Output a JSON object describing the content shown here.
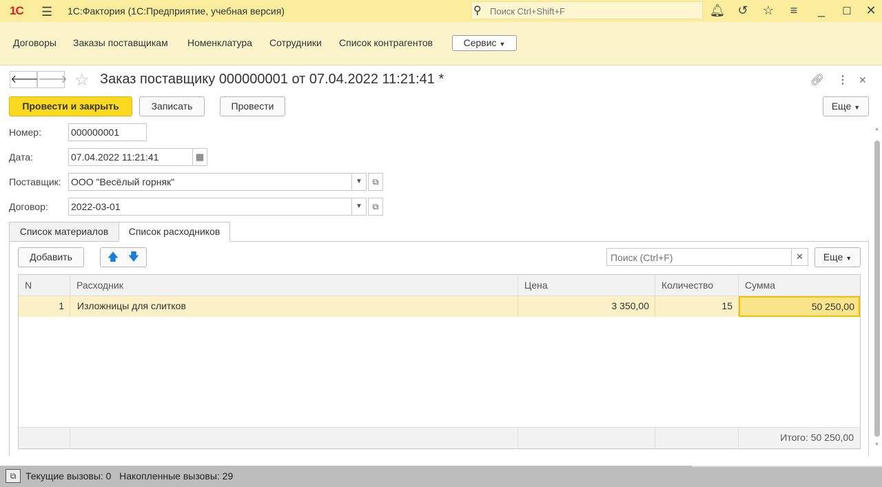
{
  "titlebar": {
    "logo": "1С",
    "app_title": "1С:Фактория  (1С:Предприятие, учебная версия)",
    "search_placeholder": "Поиск Ctrl+Shift+F"
  },
  "sections": {
    "items": [
      "Договоры",
      "Заказы поставщикам",
      "Номенклатура",
      "Сотрудники",
      "Список контрагентов"
    ],
    "service_label": "Сервис"
  },
  "form": {
    "title": "Заказ поставщику 000000001 от 07.04.2022 11:21:41 *",
    "buttons": {
      "post_close": "Провести и закрыть",
      "save": "Записать",
      "post": "Провести",
      "more": "Еще"
    },
    "fields": {
      "number_label": "Номер:",
      "number_value": "000000001",
      "date_label": "Дата:",
      "date_value": "07.04.2022 11:21:41",
      "supplier_label": "Поставщик:",
      "supplier_value": "ООО \"Весёлый горняк\"",
      "contract_label": "Договор:",
      "contract_value": "2022-03-01"
    },
    "tabs": [
      "Список материалов",
      "Список расходников"
    ],
    "active_tab": "Список расходников"
  },
  "table": {
    "add_label": "Добавить",
    "search_placeholder": "Поиск (Ctrl+F)",
    "more_label": "Еще",
    "columns": [
      "N",
      "Расходник",
      "Цена",
      "Количество",
      "Сумма"
    ],
    "rows": [
      {
        "n": "1",
        "item": "Изложницы для слитков",
        "price": "3 350,00",
        "qty": "15",
        "sum": "50 250,00"
      }
    ],
    "total": "Итого: 50 250,00"
  },
  "statusbar": {
    "text": "Текущие вызовы: 0   Накопленные вызовы: 29"
  }
}
